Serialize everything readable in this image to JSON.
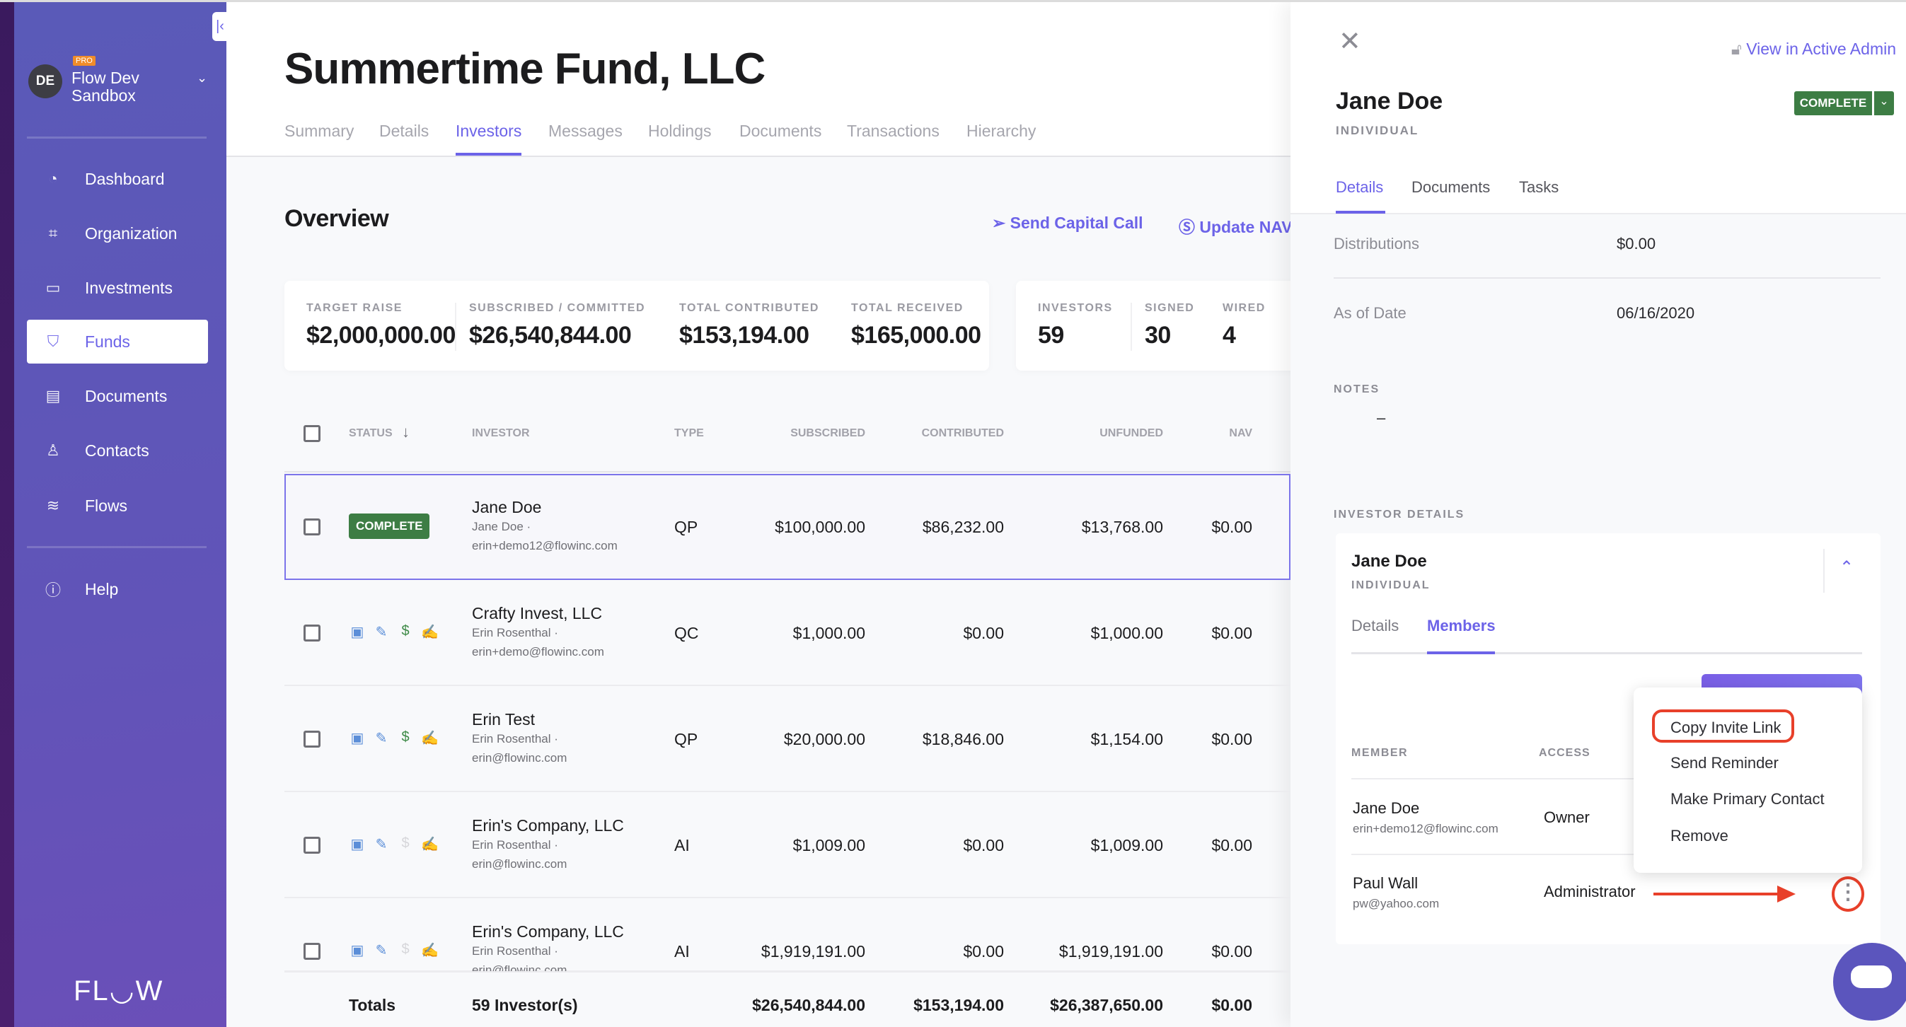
{
  "sidebar": {
    "avatar_initials": "DE",
    "plan_badge": "PRO",
    "org_name": "Flow Dev Sandbox",
    "items": [
      {
        "label": "Dashboard",
        "icon": "dashboard-icon"
      },
      {
        "label": "Organization",
        "icon": "organization-icon"
      },
      {
        "label": "Investments",
        "icon": "briefcase-icon"
      },
      {
        "label": "Funds",
        "icon": "shield-icon",
        "active": true
      },
      {
        "label": "Documents",
        "icon": "document-icon"
      },
      {
        "label": "Contacts",
        "icon": "person-icon"
      },
      {
        "label": "Flows",
        "icon": "layers-icon"
      }
    ],
    "help_label": "Help",
    "logo": "FLOW"
  },
  "page": {
    "title": "Summertime Fund, LLC",
    "tabs": [
      "Summary",
      "Details",
      "Investors",
      "Messages",
      "Holdings",
      "Documents",
      "Transactions",
      "Hierarchy"
    ],
    "active_tab": "Investors",
    "overview_title": "Overview",
    "actions": {
      "send_capital_call": "Send Capital Call",
      "update_nav": "Update NAV"
    },
    "stats": [
      {
        "label": "TARGET RAISE",
        "value": "$2,000,000.00"
      },
      {
        "label": "SUBSCRIBED / COMMITTED",
        "value": "$26,540,844.00"
      },
      {
        "label": "TOTAL CONTRIBUTED",
        "value": "$153,194.00"
      },
      {
        "label": "TOTAL RECEIVED",
        "value": "$165,000.00"
      }
    ],
    "counts": [
      {
        "label": "INVESTORS",
        "value": "59"
      },
      {
        "label": "SIGNED",
        "value": "30"
      },
      {
        "label": "WIRED",
        "value": "4"
      }
    ]
  },
  "table": {
    "columns": [
      "STATUS",
      "INVESTOR",
      "TYPE",
      "SUBSCRIBED",
      "CONTRIBUTED",
      "UNFUNDED",
      "NAV"
    ],
    "rows": [
      {
        "name": "Jane Doe",
        "contact": "Jane Doe ·",
        "email": "erin+demo12@flowinc.com",
        "type": "QP",
        "subscribed": "$100,000.00",
        "contributed": "$86,232.00",
        "unfunded": "$13,768.00",
        "nav": "$0.00",
        "status": "COMPLETE",
        "selected": true
      },
      {
        "name": "Crafty Invest, LLC",
        "contact": "Erin Rosenthal ·",
        "email": "erin+demo@flowinc.com",
        "type": "QC",
        "subscribed": "$1,000.00",
        "contributed": "$0.00",
        "unfunded": "$1,000.00",
        "nav": "$0.00",
        "steps": [
          "done",
          "done",
          "done",
          "done"
        ]
      },
      {
        "name": "Erin Test",
        "contact": "Erin Rosenthal ·",
        "email": "erin@flowinc.com",
        "type": "QP",
        "subscribed": "$20,000.00",
        "contributed": "$18,846.00",
        "unfunded": "$1,154.00",
        "nav": "$0.00",
        "steps": [
          "done",
          "done",
          "done",
          "pending"
        ]
      },
      {
        "name": "Erin's Company, LLC",
        "contact": "Erin Rosenthal ·",
        "email": "erin@flowinc.com",
        "type": "AI",
        "subscribed": "$1,009.00",
        "contributed": "$0.00",
        "unfunded": "$1,009.00",
        "nav": "$0.00",
        "steps": [
          "done",
          "done",
          "pending",
          "pending"
        ]
      },
      {
        "name": "Erin's Company, LLC",
        "contact": "Erin Rosenthal ·",
        "email": "erin@flowinc.com",
        "type": "AI",
        "subscribed": "$1,919,191.00",
        "contributed": "$0.00",
        "unfunded": "$1,919,191.00",
        "nav": "$0.00",
        "steps": [
          "done",
          "done",
          "pending",
          "pending"
        ]
      }
    ],
    "totals": {
      "label": "Totals",
      "investors": "59 Investor(s)",
      "subscribed": "$26,540,844.00",
      "contributed": "$153,194.00",
      "unfunded": "$26,387,650.00",
      "nav": "$0.00"
    }
  },
  "panel": {
    "admin_link": "View in Active Admin",
    "name": "Jane Doe",
    "entity_type": "INDIVIDUAL",
    "status": "COMPLETE",
    "tabs": [
      "Details",
      "Documents",
      "Tasks"
    ],
    "fields": [
      {
        "label": "Distributions",
        "value": "$0.00"
      },
      {
        "label": "As of Date",
        "value": "06/16/2020"
      }
    ],
    "notes_label": "NOTES",
    "notes_value": "–",
    "investor_details_label": "INVESTOR DETAILS",
    "card": {
      "name": "Jane Doe",
      "entity_type": "INDIVIDUAL",
      "tabs": [
        "Details",
        "Members"
      ],
      "columns": [
        "MEMBER",
        "ACCESS"
      ],
      "members": [
        {
          "name": "Jane Doe",
          "email": "erin+demo12@flowinc.com",
          "access": "Owner"
        },
        {
          "name": "Paul Wall",
          "email": "pw@yahoo.com",
          "access": "Administrator"
        }
      ]
    },
    "menu": [
      "Copy Invite Link",
      "Send Reminder",
      "Make Primary Contact",
      "Remove"
    ]
  },
  "colors": {
    "accent": "#6c63e8",
    "complete": "#3d7d44",
    "sidebar": "#5e57b8",
    "annotation": "#e8402a",
    "step_done_blue": "#5b8ed8",
    "step_done_green": "#3d8a46",
    "step_pending": "#d6d6da"
  }
}
